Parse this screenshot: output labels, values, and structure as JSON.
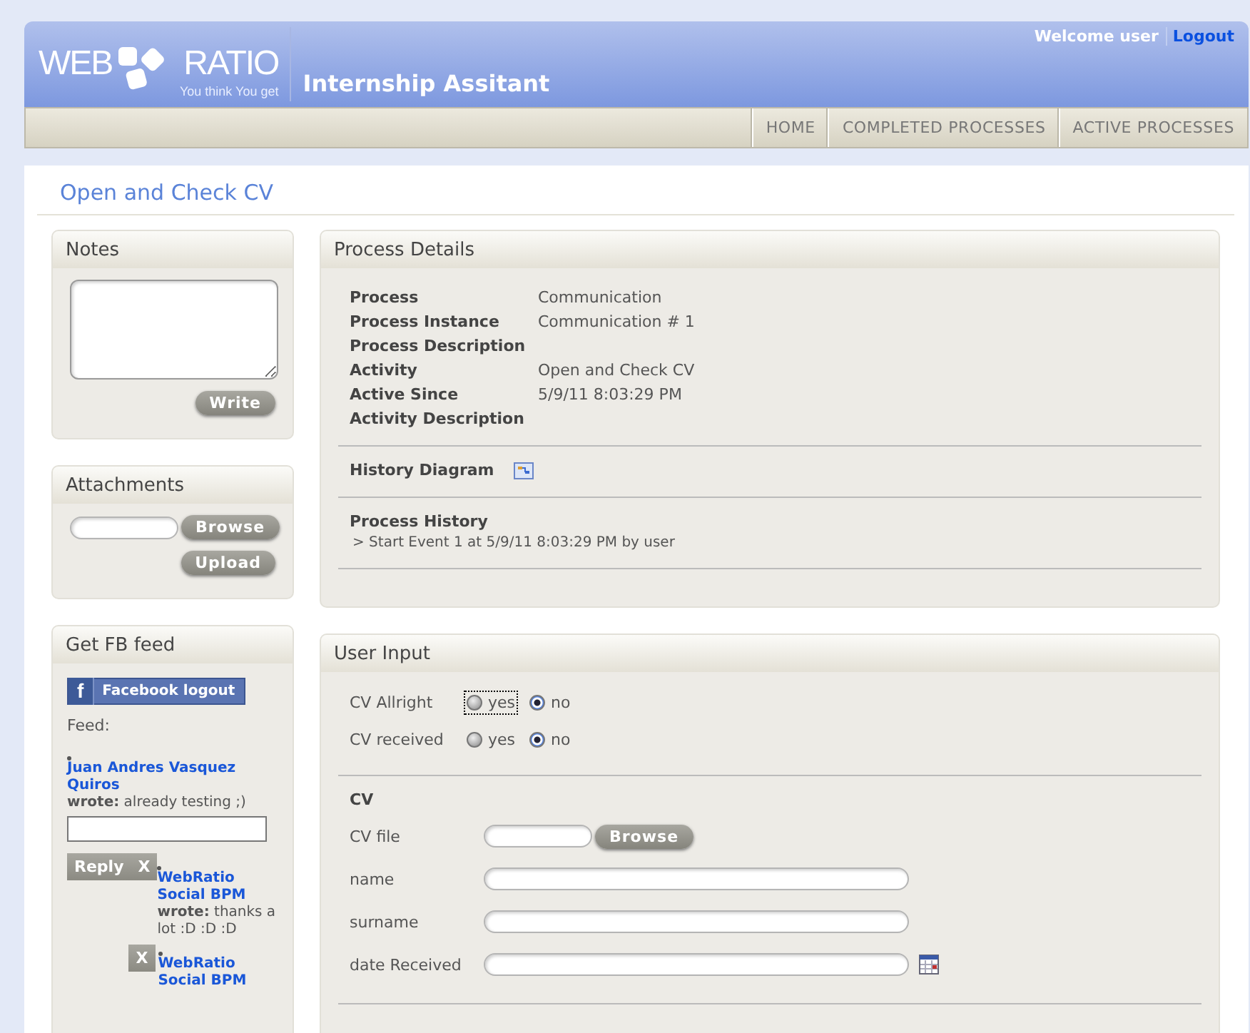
{
  "header": {
    "logo": {
      "left": "WEB",
      "right": "RATIO",
      "tagline": "You think You get"
    },
    "app_title": "Internship Assitant",
    "welcome": "Welcome user",
    "logout": "Logout"
  },
  "nav": [
    {
      "label": "HOME"
    },
    {
      "label": "COMPLETED PROCESSES"
    },
    {
      "label": "ACTIVE PROCESSES"
    }
  ],
  "page_title": "Open and Check CV",
  "notes": {
    "title": "Notes",
    "button": "Write"
  },
  "attachments": {
    "title": "Attachments",
    "browse": "Browse",
    "upload": "Upload"
  },
  "fb": {
    "title": "Get FB feed",
    "logout_icon": "f",
    "logout_button": "Facebook logout",
    "feed_label": "Feed:",
    "posts": [
      {
        "author": "Juan Andres Vasquez Quiros",
        "text": "**wrote:** already testing ;)",
        "reply": "Reply",
        "delete": "X",
        "children": [
          {
            "author": "WebRatio Social BPM",
            "text": "**wrote:** thanks a lot :D :D :D",
            "delete": "X"
          },
          {
            "author": "WebRatio Social BPM"
          }
        ]
      }
    ]
  },
  "process_details": {
    "title": "Process Details",
    "fields": [
      {
        "label": "Process",
        "value": "Communication"
      },
      {
        "label": "Process Instance",
        "value": "Communication # 1"
      },
      {
        "label": "Process Description"
      },
      {
        "label": "Activity",
        "value": "Open and Check CV"
      },
      {
        "label": "Active Since",
        "value": "5/9/11 8:03:29 PM"
      },
      {
        "label": "Activity Description"
      }
    ],
    "history_diagram": "History Diagram",
    "history_title": "Process History",
    "history": [
      "> Start Event 1 at 5/9/11 8:03:29 PM by user"
    ]
  },
  "user_input": {
    "title": "User Input",
    "radios": [
      {
        "label": "CV Allright",
        "options": [
          {
            "label": "yes",
            "selected": false,
            "focused": true
          },
          {
            "label": "no",
            "selected": true,
            "focused": false
          }
        ]
      },
      {
        "label": "CV received",
        "options": [
          {
            "label": "yes",
            "selected": false,
            "focused": false
          },
          {
            "label": "no",
            "selected": true,
            "focused": false
          }
        ]
      }
    ],
    "section": "CV",
    "fields": [
      {
        "kind": "file",
        "label": "CV file",
        "button": "Browse"
      },
      {
        "kind": "text",
        "label": "name"
      },
      {
        "kind": "text",
        "label": "surname"
      },
      {
        "kind": "date",
        "label": "date Received"
      }
    ]
  }
}
